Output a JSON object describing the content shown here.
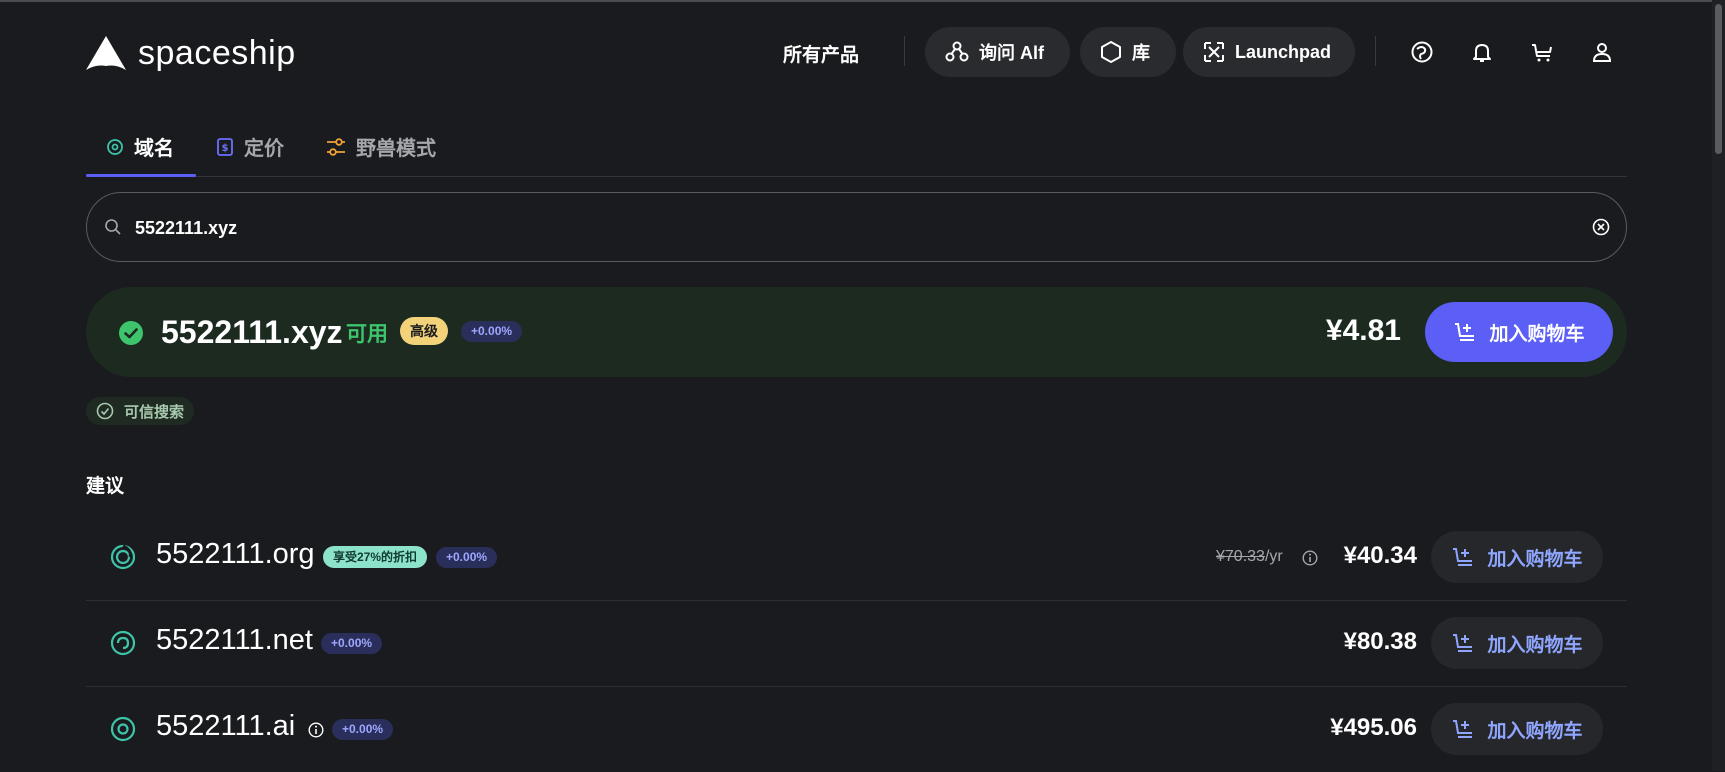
{
  "header": {
    "logo_text": "spaceship",
    "nav_all_products": "所有产品",
    "pill_alf": "询问 Alf",
    "pill_library": "库",
    "pill_launchpad": "Launchpad",
    "icons": [
      "help-icon",
      "bell-icon",
      "cart-icon",
      "user-icon"
    ]
  },
  "tabs": [
    {
      "label": "域名",
      "active": true,
      "icon": "domain-icon",
      "color": "#3ec4a8"
    },
    {
      "label": "定价",
      "active": false,
      "icon": "pricing-icon",
      "color": "#6b70ff"
    },
    {
      "label": "野兽模式",
      "active": false,
      "icon": "sliders-icon",
      "color": "#f0a23a"
    }
  ],
  "search": {
    "value": "5522111.xyz",
    "placeholder": ""
  },
  "result": {
    "domain": "5522111.xyz",
    "status": "可用",
    "premium_badge": "高级",
    "change_badge": "+0.00%",
    "price": "¥4.81",
    "add_to_cart": "加入购物车"
  },
  "trust_badge": "可信搜索",
  "suggestions_title": "建议",
  "suggestions": [
    {
      "domain": "5522111.org",
      "discount_badge": "享受27%的折扣",
      "change_badge": "+0.00%",
      "original_price": "¥70.33",
      "per": "/yr",
      "price": "¥40.34",
      "add_to_cart": "加入购物车",
      "icon": "org-icon"
    },
    {
      "domain": "5522111.net",
      "change_badge": "+0.00%",
      "price": "¥80.38",
      "add_to_cart": "加入购物车",
      "icon": "net-icon"
    },
    {
      "domain": "5522111.ai",
      "change_badge": "+0.00%",
      "price": "¥495.06",
      "add_to_cart": "加入购物车",
      "icon": "ai-icon"
    }
  ],
  "colors": {
    "background": "#1a1b1e",
    "accent": "#5b5ff6",
    "available_green": "#3ec46d",
    "premium_yellow": "#f2d37a",
    "discount_teal": "#8de2cc"
  }
}
